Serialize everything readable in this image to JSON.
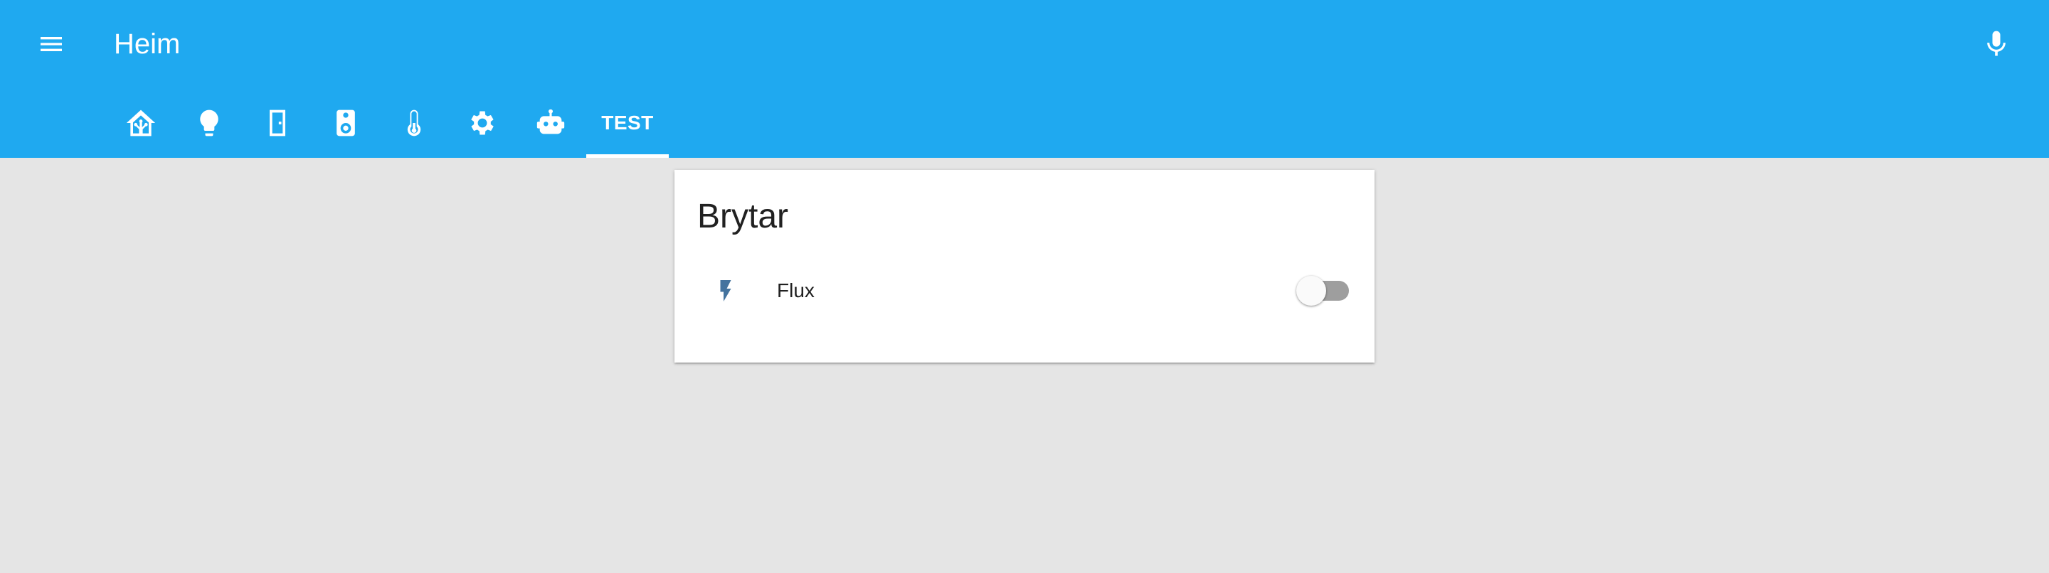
{
  "header": {
    "title": "Heim",
    "menu_icon": "menu-icon",
    "mic_icon": "microphone-icon",
    "background_color": "#1fa9f0"
  },
  "tabs": [
    {
      "icon": "home-assistant-icon",
      "selected": false
    },
    {
      "icon": "lightbulb-icon",
      "selected": false
    },
    {
      "icon": "door-icon",
      "selected": false
    },
    {
      "icon": "speaker-icon",
      "selected": false
    },
    {
      "icon": "thermometer-icon",
      "selected": false
    },
    {
      "icon": "settings-icon",
      "selected": false
    },
    {
      "icon": "robot-icon",
      "selected": false
    },
    {
      "label": "TEST",
      "selected": true
    }
  ],
  "card": {
    "title": "Brytar",
    "entities": [
      {
        "name": "Flux",
        "icon": "flash-icon",
        "icon_color": "#44739e",
        "state": "off"
      }
    ]
  }
}
